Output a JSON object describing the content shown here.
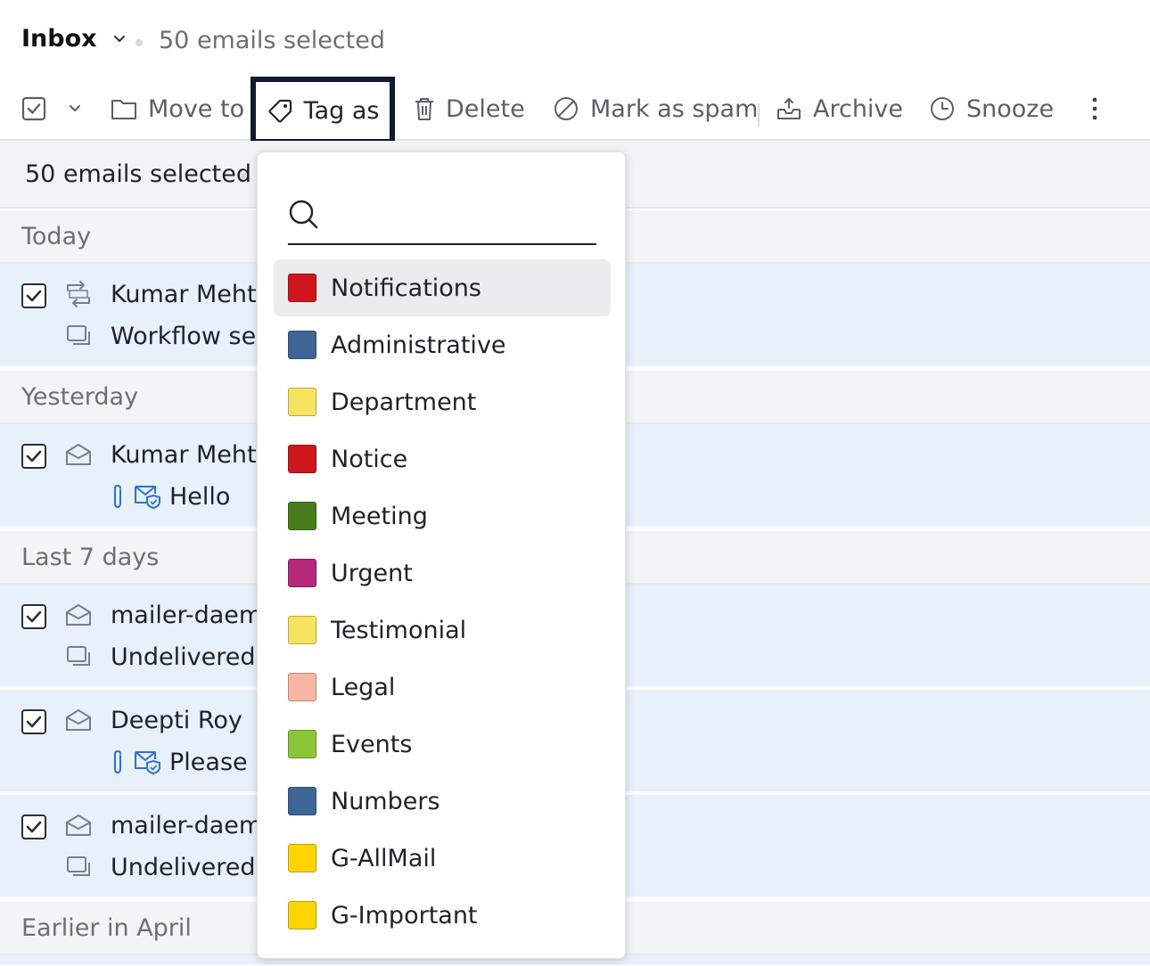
{
  "header": {
    "folder": "Inbox",
    "selected_text": "50 emails selected"
  },
  "toolbar": {
    "move_to": "Move to",
    "tag_as": "Tag as",
    "delete": "Delete",
    "mark_spam": "Mark as spam",
    "archive": "Archive",
    "snooze": "Snooze"
  },
  "selection_bar": {
    "text": "50 emails selected"
  },
  "groups": {
    "today": "Today",
    "yesterday": "Yesterday",
    "last7": "Last 7 days",
    "earlier": "Earlier in April"
  },
  "mails": [
    {
      "sender": "Kumar Mehta",
      "subject": "Workflow set"
    },
    {
      "sender": "Kumar Mehta",
      "subject": "Hello"
    },
    {
      "sender": "mailer-daemo",
      "subject": "Undelivered M"
    },
    {
      "sender": "Deepti Roy",
      "subject": "Please re"
    },
    {
      "sender": "mailer-daemo",
      "subject": "Undelivered M"
    }
  ],
  "tag_menu": {
    "search_placeholder": "",
    "tags": [
      {
        "label": "Notifications",
        "color": "#d0161d"
      },
      {
        "label": "Administrative",
        "color": "#3d6697"
      },
      {
        "label": "Department",
        "color": "#f6e35f"
      },
      {
        "label": "Notice",
        "color": "#d0161d"
      },
      {
        "label": "Meeting",
        "color": "#4a7c1d"
      },
      {
        "label": "Urgent",
        "color": "#b5287a"
      },
      {
        "label": "Testimonial",
        "color": "#f6e35f"
      },
      {
        "label": "Legal",
        "color": "#f8b7a4"
      },
      {
        "label": "Events",
        "color": "#8bc53a"
      },
      {
        "label": "Numbers",
        "color": "#3d6697"
      },
      {
        "label": "G-AllMail",
        "color": "#ffd400"
      },
      {
        "label": "G-Important",
        "color": "#ffd400"
      }
    ]
  }
}
